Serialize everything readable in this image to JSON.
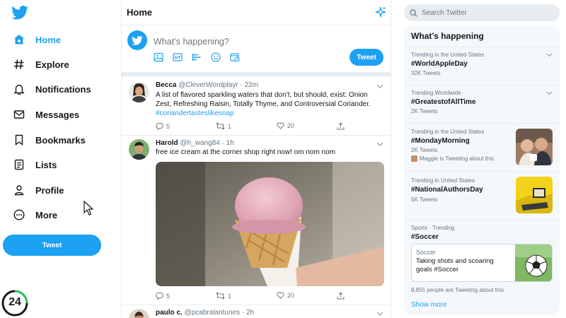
{
  "nav": {
    "items": [
      {
        "label": "Home",
        "icon": "home-icon"
      },
      {
        "label": "Explore",
        "icon": "hashtag-icon"
      },
      {
        "label": "Notifications",
        "icon": "bell-icon"
      },
      {
        "label": "Messages",
        "icon": "envelope-icon"
      },
      {
        "label": "Bookmarks",
        "icon": "bookmark-icon"
      },
      {
        "label": "Lists",
        "icon": "list-icon"
      },
      {
        "label": "Profile",
        "icon": "person-icon"
      },
      {
        "label": "More",
        "icon": "more-circle-icon"
      }
    ],
    "tweet_label": "Tweet",
    "badge_text": "24"
  },
  "main": {
    "title": "Home",
    "compose": {
      "placeholder": "What’s happening?",
      "tweet_label": "Tweet"
    },
    "tweets": [
      {
        "name": "Becca",
        "handle": "@CleverWordplayr · 22m",
        "text": "A list of flavored sparkling waters that don’t, but should, exist: Onion Zest, Refreshing Raisin, Totally Thyme, and Controversial Coriander.",
        "hashtag": "#coriandertasteslikesoap",
        "replies": "5",
        "retweets": "1",
        "likes": "20"
      },
      {
        "name": "Harold",
        "handle": "@h_wang84 · 1h",
        "text": "free ice cream at the corner shop right now! om nom nom",
        "replies": "5",
        "retweets": "1",
        "likes": "20"
      },
      {
        "name": "paulo c.",
        "handle": "@pcabralantunes · 2h"
      }
    ]
  },
  "right": {
    "search_placeholder": "Search Twitter",
    "trends_title": "What’s happening",
    "trends": [
      {
        "meta": "Trending in the United States",
        "tag": "#WorldAppleDay",
        "count": "32K Tweets"
      },
      {
        "meta": "Trending Worldwide",
        "tag": "#GreatestofAllTime",
        "count": "2K Tweets"
      },
      {
        "meta": "Trending in the United States",
        "tag": "#MondayMorning",
        "count": "2K Tweets",
        "extra": "Maggie is Tweeting about this"
      },
      {
        "meta": "Trending in United States",
        "tag": "#NationalAuthorsDay",
        "count": "5K Tweets"
      },
      {
        "meta": "Sports · Trending",
        "tag": "#Soccer",
        "card_category": "Soccer",
        "card_text": "Taking shots and scoaring goals #Soccer",
        "count": "8,855 people are Tweeting about this"
      }
    ],
    "show_more": "Show more"
  },
  "colors": {
    "accent": "#1da1f2",
    "text": "#14171a",
    "secondary": "#657786",
    "border": "#e6ecf0"
  }
}
